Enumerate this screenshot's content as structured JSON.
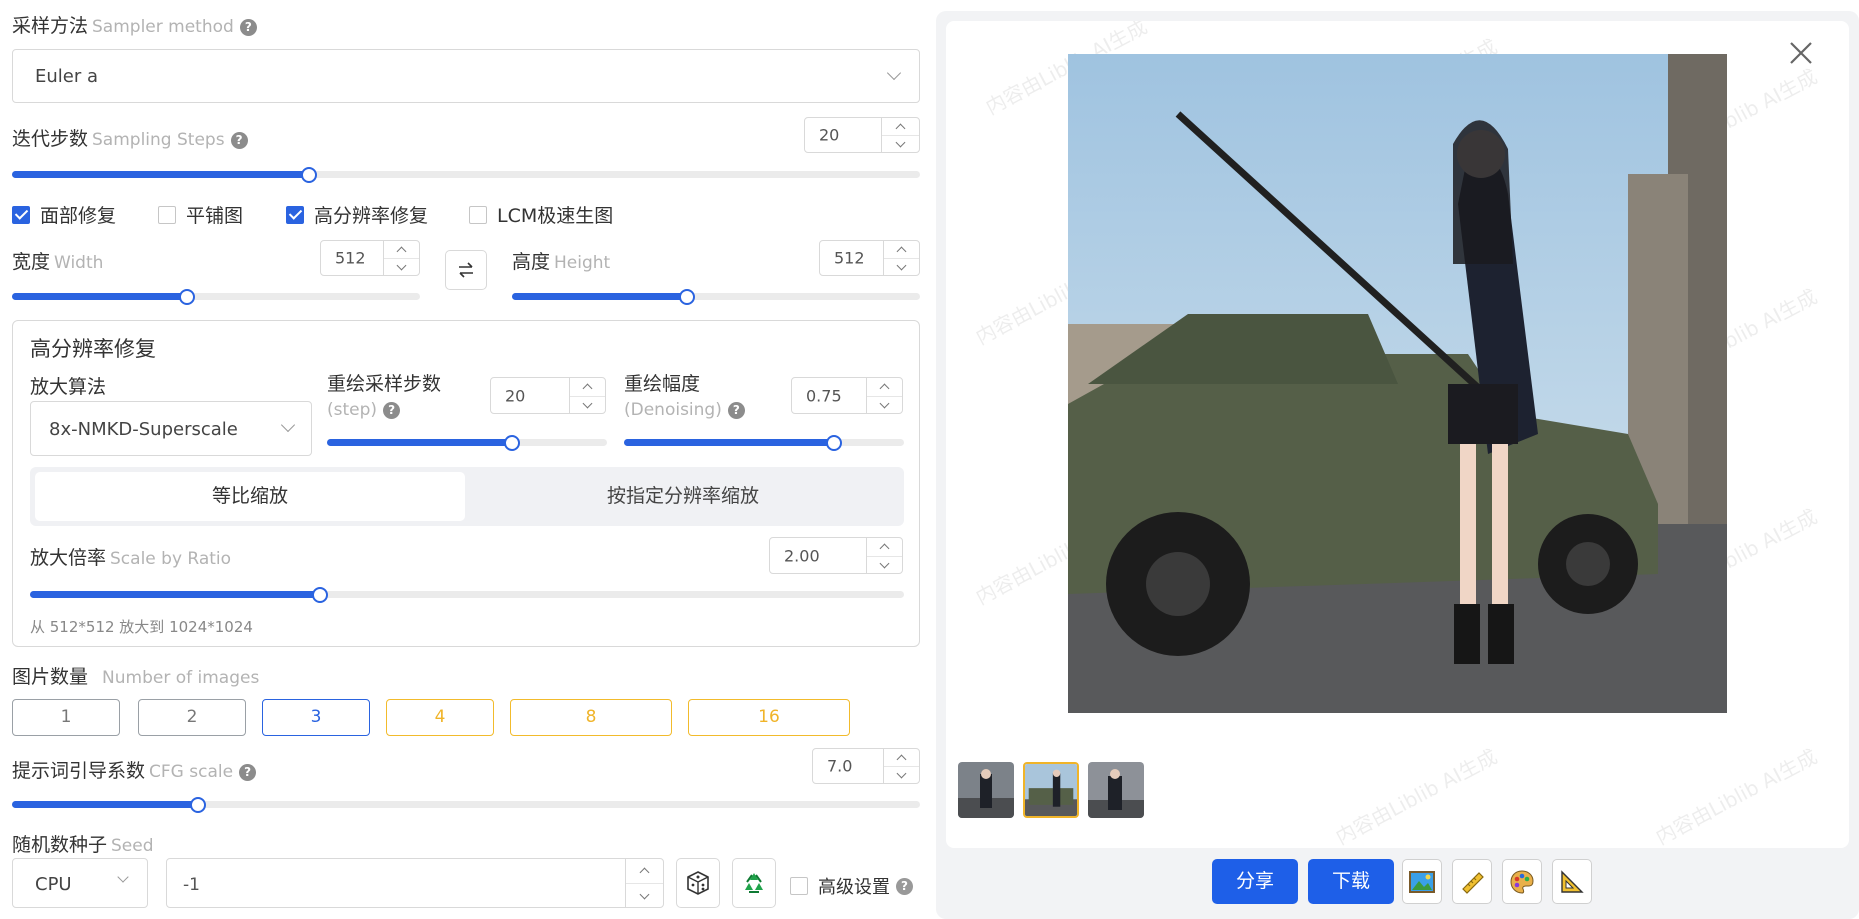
{
  "sampler": {
    "label_cn": "采样方法",
    "label_en": "Sampler method",
    "value": "Euler a"
  },
  "steps": {
    "label_cn": "迭代步数",
    "label_en": "Sampling Steps",
    "value": "20",
    "fill_fraction": 0.327
  },
  "options": [
    {
      "label": "面部修复",
      "checked": true
    },
    {
      "label": "平铺图",
      "checked": false
    },
    {
      "label": "高分辨率修复",
      "checked": true
    },
    {
      "label": "LCM极速生图",
      "checked": false
    }
  ],
  "width": {
    "label_cn": "宽度",
    "label_en": "Width",
    "value": "512",
    "fill_fraction": 0.43
  },
  "height": {
    "label_cn": "高度",
    "label_en": "Height",
    "value": "512",
    "fill_fraction": 0.43
  },
  "hires": {
    "title": "高分辨率修复",
    "upscaler": {
      "label": "放大算法",
      "value": "8x-NMKD-Superscale"
    },
    "hires_steps": {
      "label_cn": "重绘采样步数",
      "label_en": "(step)",
      "value": "20",
      "fill_fraction": 0.66
    },
    "denoising": {
      "label_cn": "重绘幅度",
      "label_en": "(Denoising)",
      "value": "0.75",
      "fill_fraction": 0.75
    },
    "tabs": [
      "等比缩放",
      "按指定分辨率缩放"
    ],
    "scale": {
      "label_cn": "放大倍率",
      "label_en": "Scale by Ratio",
      "value": "2.00",
      "fill_fraction": 0.332
    },
    "note": "从 512*512 放大到 1024*1024"
  },
  "num_images": {
    "label_cn": "图片数量",
    "label_en": "Number of images",
    "options": [
      "1",
      "2",
      "3",
      "4",
      "8",
      "16"
    ],
    "selected": "3"
  },
  "cfg": {
    "label_cn": "提示词引导系数",
    "label_en": "CFG scale",
    "value": "7.0",
    "fill_fraction": 0.205
  },
  "seed": {
    "label_cn": "随机数种子",
    "label_en": "Seed",
    "device": "CPU",
    "value": "-1",
    "advanced_label": "高级设置"
  },
  "preview": {
    "watermark": "内容由Liblib AI生成",
    "actions": {
      "share": "分享",
      "download": "下载"
    },
    "thumbnails": 3,
    "selected_thumbnail": 2
  },
  "colors": {
    "accent": "#2a63e0",
    "gold": "#f0b429",
    "button": "#1e5fe8"
  }
}
